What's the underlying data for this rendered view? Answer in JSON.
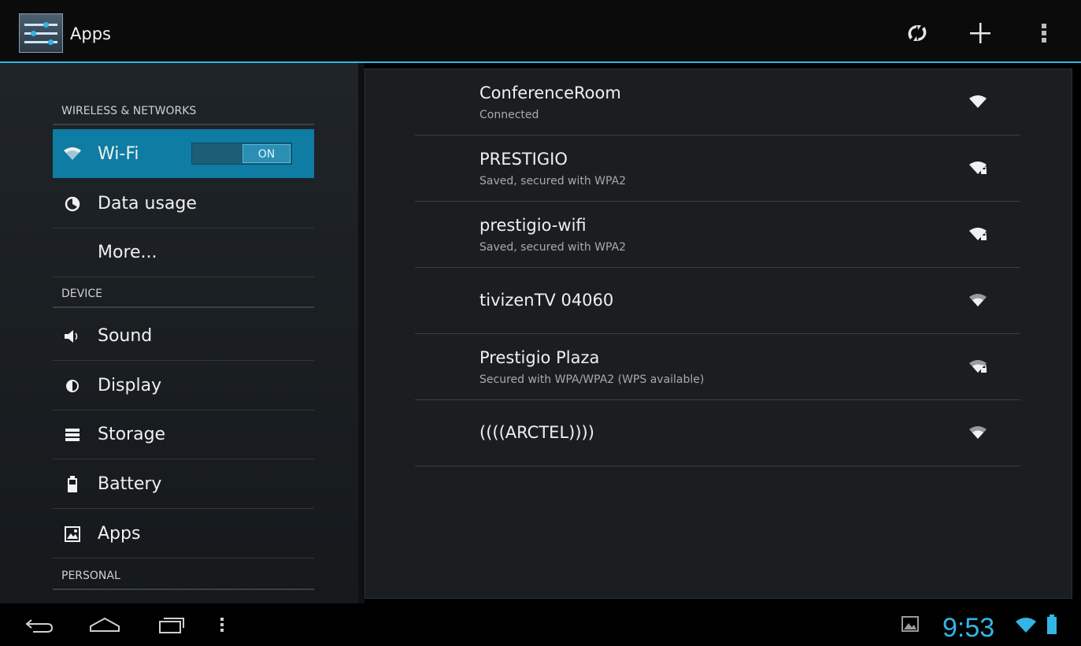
{
  "action_bar": {
    "title": "Apps"
  },
  "sidebar": {
    "sections": [
      {
        "header": "WIRELESS & NETWORKS"
      },
      {
        "header": "DEVICE"
      },
      {
        "header": "PERSONAL"
      }
    ],
    "items": [
      {
        "label": "Wi-Fi",
        "icon": "wifi-icon",
        "selected": true,
        "toggle": "ON"
      },
      {
        "label": "Data usage",
        "icon": "data-usage-icon"
      },
      {
        "label": "More..."
      },
      {
        "label": "Sound",
        "icon": "speaker-icon"
      },
      {
        "label": "Display",
        "icon": "brightness-icon"
      },
      {
        "label": "Storage",
        "icon": "storage-icon"
      },
      {
        "label": "Battery",
        "icon": "battery-icon"
      },
      {
        "label": "Apps",
        "icon": "apps-icon"
      }
    ]
  },
  "networks": [
    {
      "name": "ConferenceRoom",
      "status": "Connected",
      "secured": false
    },
    {
      "name": "PRESTIGIO",
      "status": "Saved, secured with WPA2",
      "secured": true
    },
    {
      "name": "prestigio-wifi",
      "status": "Saved, secured with WPA2",
      "secured": true
    },
    {
      "name": "tivizenTV 04060",
      "status": "",
      "secured": false
    },
    {
      "name": "Prestigio Plaza",
      "status": "Secured with WPA/WPA2 (WPS available)",
      "secured": true
    },
    {
      "name": "((((ARCTEL))))",
      "status": "",
      "secured": false
    }
  ],
  "status_bar": {
    "time": "9:53"
  },
  "colors": {
    "accent": "#33b5e5",
    "selected_bg": "#0e7ca3"
  }
}
